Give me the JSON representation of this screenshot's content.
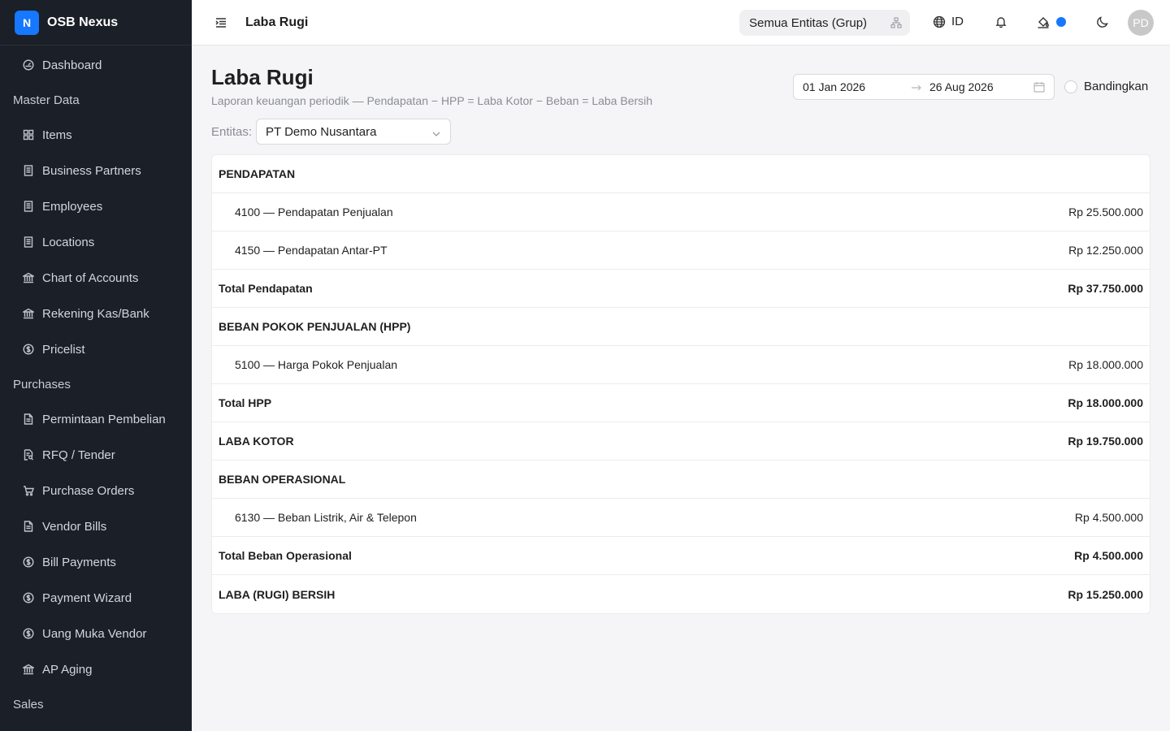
{
  "app": {
    "logo_letter": "N",
    "name": "OSB Nexus"
  },
  "sidebar": {
    "entries": [
      {
        "type": "item",
        "label": "Dashboard",
        "icon": "dashboard-icon"
      },
      {
        "type": "group",
        "label": "Master Data"
      },
      {
        "type": "item",
        "label": "Items",
        "icon": "grid-icon"
      },
      {
        "type": "item",
        "label": "Business Partners",
        "icon": "building-icon"
      },
      {
        "type": "item",
        "label": "Employees",
        "icon": "building-icon"
      },
      {
        "type": "item",
        "label": "Locations",
        "icon": "building-icon"
      },
      {
        "type": "item",
        "label": "Chart of Accounts",
        "icon": "bank-icon"
      },
      {
        "type": "item",
        "label": "Rekening Kas/Bank",
        "icon": "bank-icon"
      },
      {
        "type": "item",
        "label": "Pricelist",
        "icon": "dollar-circle-icon"
      },
      {
        "type": "group",
        "label": "Purchases"
      },
      {
        "type": "item",
        "label": "Permintaan Pembelian",
        "icon": "document-icon"
      },
      {
        "type": "item",
        "label": "RFQ / Tender",
        "icon": "document-search-icon"
      },
      {
        "type": "item",
        "label": "Purchase Orders",
        "icon": "cart-icon"
      },
      {
        "type": "item",
        "label": "Vendor Bills",
        "icon": "document-icon"
      },
      {
        "type": "item",
        "label": "Bill Payments",
        "icon": "dollar-circle-icon"
      },
      {
        "type": "item",
        "label": "Payment Wizard",
        "icon": "dollar-circle-icon"
      },
      {
        "type": "item",
        "label": "Uang Muka Vendor",
        "icon": "dollar-circle-icon"
      },
      {
        "type": "item",
        "label": "AP Aging",
        "icon": "bank-icon"
      },
      {
        "type": "group",
        "label": "Sales"
      }
    ]
  },
  "header": {
    "title": "Laba Rugi",
    "entity_switcher": "Semua Entitas (Grup)",
    "language": "ID",
    "avatar_initials": "PD",
    "accent_color": "#1677ff"
  },
  "main": {
    "title": "Laba Rugi",
    "subtitle": "Laporan keuangan periodik — Pendapatan − HPP = Laba Kotor − Beban = Laba Bersih",
    "date_from": "01 Jan 2026",
    "date_to": "26 Aug 2026",
    "compare_label": "Bandingkan",
    "entity_label": "Entitas:",
    "entity_value": "PT Demo Nusantara"
  },
  "report": {
    "rows": [
      {
        "kind": "section",
        "label": "PENDAPATAN",
        "amount": ""
      },
      {
        "kind": "item",
        "label": "4100 — Pendapatan Penjualan",
        "amount": "Rp 25.500.000"
      },
      {
        "kind": "item",
        "label": "4150 — Pendapatan Antar-PT",
        "amount": "Rp 12.250.000"
      },
      {
        "kind": "total",
        "label": "Total Pendapatan",
        "amount": "Rp 37.750.000"
      },
      {
        "kind": "section",
        "label": "BEBAN POKOK PENJUALAN (HPP)",
        "amount": ""
      },
      {
        "kind": "item",
        "label": "5100 — Harga Pokok Penjualan",
        "amount": "Rp 18.000.000"
      },
      {
        "kind": "total",
        "label": "Total HPP",
        "amount": "Rp 18.000.000"
      },
      {
        "kind": "total",
        "label": "LABA KOTOR",
        "amount": "Rp 19.750.000"
      },
      {
        "kind": "section",
        "label": "BEBAN OPERASIONAL",
        "amount": ""
      },
      {
        "kind": "item",
        "label": "6130 — Beban Listrik, Air & Telepon",
        "amount": "Rp 4.500.000"
      },
      {
        "kind": "total",
        "label": "Total Beban Operasional",
        "amount": "Rp 4.500.000"
      },
      {
        "kind": "total",
        "label": "LABA (RUGI) BERSIH",
        "amount": "Rp 15.250.000"
      }
    ]
  }
}
